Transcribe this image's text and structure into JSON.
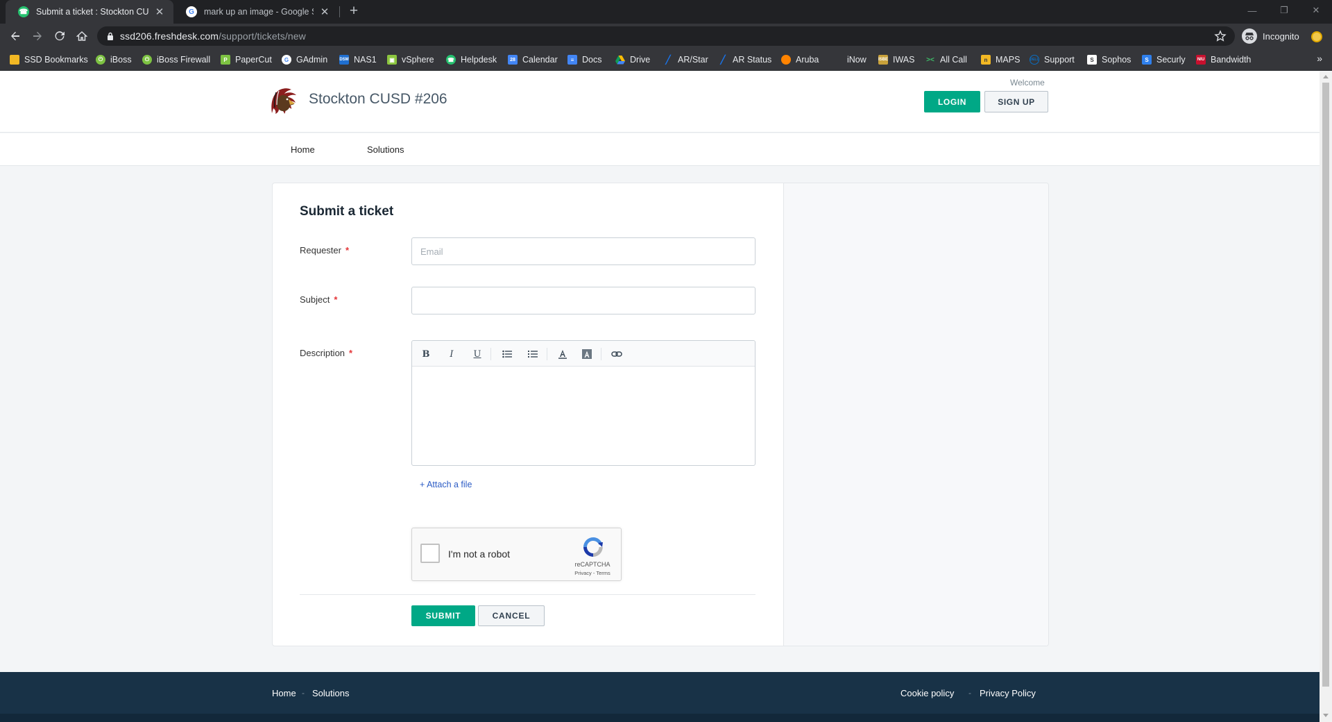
{
  "browser": {
    "tabs": [
      {
        "title": "Submit a ticket : Stockton CUSD",
        "active": true,
        "favicon": "freshdesk-icon"
      },
      {
        "title": "mark up an image - Google Sear",
        "active": false,
        "favicon": "google-icon"
      }
    ],
    "url_host": "ssd206.freshdesk.com",
    "url_path": "/support/tickets/new",
    "profile_label": "Incognito",
    "bookmarks": [
      {
        "label": "SSD Bookmarks",
        "icon": "folder-icon",
        "color": "#f2b824"
      },
      {
        "label": "iBoss",
        "icon": "power-icon",
        "color": "#7dc242"
      },
      {
        "label": "iBoss Firewall",
        "icon": "power-icon",
        "color": "#7dc242"
      },
      {
        "label": "PaperCut",
        "icon": "papercut-icon",
        "color": "#7dc242"
      },
      {
        "label": "GAdmin",
        "icon": "google-icon",
        "color": "#ffffff"
      },
      {
        "label": "NAS1",
        "icon": "nas-icon",
        "color": "#1f6fd1"
      },
      {
        "label": "vSphere",
        "icon": "vsphere-icon",
        "color": "#8cc63f"
      },
      {
        "label": "Helpdesk",
        "icon": "freshdesk-icon",
        "color": "#25c16f"
      },
      {
        "label": "Calendar",
        "icon": "calendar-icon",
        "color": "#4285f4"
      },
      {
        "label": "Docs",
        "icon": "docs-icon",
        "color": "#4285f4"
      },
      {
        "label": "Drive",
        "icon": "drive-icon",
        "color": "#fbbc04"
      },
      {
        "label": "AR/Star",
        "icon": "arstar-icon",
        "color": "#1a73e8"
      },
      {
        "label": "AR Status",
        "icon": "arstar-icon",
        "color": "#1a73e8"
      },
      {
        "label": "Aruba",
        "icon": "aruba-icon",
        "color": "#ff8300"
      },
      {
        "label": "iNow",
        "icon": "blank-icon",
        "color": "#35363a"
      },
      {
        "label": "IWAS",
        "icon": "isbe-icon",
        "color": "#c8a13a"
      },
      {
        "label": "All Call",
        "icon": "allcall-icon",
        "color": "#3ec16a"
      },
      {
        "label": "MAPS",
        "icon": "maps-icon",
        "color": "#f2b824"
      },
      {
        "label": "Support",
        "icon": "dell-icon",
        "color": "#0a6ec3"
      },
      {
        "label": "Sophos",
        "icon": "sophos-icon",
        "color": "#ffffff"
      },
      {
        "label": "Securly",
        "icon": "securly-icon",
        "color": "#2f80ed"
      },
      {
        "label": "Bandwidth",
        "icon": "niu-icon",
        "color": "#c8102e"
      }
    ]
  },
  "header": {
    "brand": "Stockton CUSD #206",
    "welcome": "Welcome",
    "login_label": "LOGIN",
    "signup_label": "SIGN UP"
  },
  "nav": {
    "home": "Home",
    "solutions": "Solutions"
  },
  "form": {
    "title": "Submit a ticket",
    "requester_label": "Requester",
    "requester_placeholder": "Email",
    "requester_value": "",
    "subject_label": "Subject",
    "subject_value": "",
    "description_label": "Description",
    "required_mark": "*",
    "toolbar": {
      "bold": "B",
      "italic": "I",
      "underline": "U"
    },
    "attach_label": "+ Attach a file",
    "recaptcha_text": "I'm not a robot",
    "recaptcha_brand": "reCAPTCHA",
    "recaptcha_links": "Privacy - Terms",
    "submit_label": "SUBMIT",
    "cancel_label": "CANCEL"
  },
  "footer": {
    "home": "Home",
    "solutions": "Solutions",
    "cookie": "Cookie policy",
    "privacy": "Privacy Policy",
    "separator": "-"
  },
  "colors": {
    "primary_green": "#00a886",
    "footer_bg": "#183247",
    "required_red": "#e43538",
    "link_blue": "#2c5cc5"
  }
}
